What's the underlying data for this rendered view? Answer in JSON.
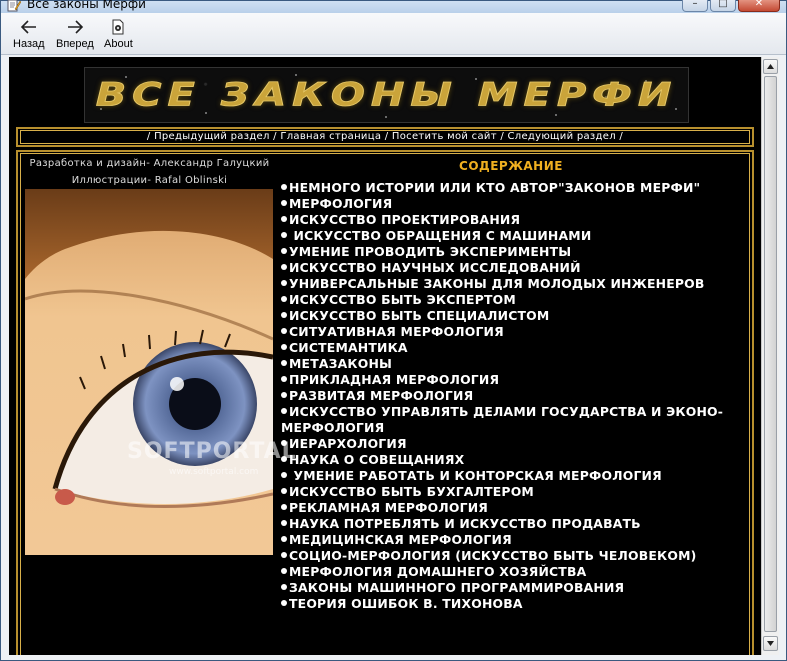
{
  "window": {
    "title": "Все законы Мерфи",
    "controls": {
      "minimize": "–",
      "maximize": "□",
      "close": "✕"
    }
  },
  "toolbar": {
    "back_label": "Назад",
    "forward_label": "Вперед",
    "about_label": "About"
  },
  "banner": {
    "text": "ВСЕ ЗАКОНЫ МЕРФИ"
  },
  "nav": {
    "sep": "/",
    "prev": "Предыдущий раздел",
    "home": "Главная страница",
    "visit": "Посетить мой сайт",
    "next": "Следующий раздел"
  },
  "credits": {
    "design": "Разработка и дизайн- Александр Галуцкий",
    "illustrations": "Иллюстрации- Rafal Oblinski"
  },
  "watermark": {
    "main": "SOFTPORTAL",
    "sub": "www.softportal.com"
  },
  "toc": {
    "title": "СОДЕРЖАНИЕ",
    "items": [
      "НЕМНОГО ИСТОРИИ ИЛИ КТО АВТОР\"ЗАКОНОВ МЕРФИ\"",
      "МЕРФОЛОГИЯ",
      "ИСКУССТВО ПРОЕКТИРОВАНИЯ",
      " ИСКУССТВО ОБРАЩЕНИЯ С МАШИНАМИ",
      "УМЕНИЕ ПРОВОДИТЬ ЭКСПЕРИМЕНТЫ",
      "ИСКУССТВО НАУЧНЫХ ИССЛЕДОВАНИЙ",
      "УНИВЕРСАЛЬНЫЕ ЗАКОНЫ ДЛЯ МОЛОДЫХ ИНЖЕНЕРОВ",
      "ИСКУССТВО БЫТЬ ЭКСПЕРТОМ",
      "ИСКУССТВО БЫТЬ СПЕЦИАЛИСТОМ",
      "СИТУАТИВНАЯ МЕРФОЛОГИЯ",
      "СИСТЕМАНТИКА",
      "МЕТАЗАКОНЫ",
      "ПРИКЛАДНАЯ МЕРФОЛОГИЯ",
      "РАЗВИТАЯ МЕРФОЛОГИЯ",
      "ИСКУССТВО УПРАВЛЯТЬ ДЕЛАМИ ГОСУДАРСТВА И ЭКОНО-МЕРФОЛОГИЯ",
      "ИЕРАРХОЛОГИЯ",
      "НАУКА О СОВЕЩАНИЯХ",
      " УМЕНИЕ РАБОТАТЬ И КОНТОРСКАЯ МЕРФОЛОГИЯ",
      "ИСКУССТВО БЫТЬ БУХГАЛТЕРОМ",
      "РЕКЛАМНАЯ МЕРФОЛОГИЯ",
      "НАУКА ПОТРЕБЛЯТЬ И ИСКУССТВО ПРОДАВАТЬ",
      "МЕДИЦИНСКАЯ МЕРФОЛОГИЯ",
      "СОЦИО-МЕРФОЛОГИЯ (ИСКУССТВО БЫТЬ ЧЕЛОВЕКОМ)",
      "МЕРФОЛОГИЯ ДОМАШНЕГО ХОЗЯЙСТВА",
      "ЗАКОНЫ МАШИННОГО ПРОГРАММИРОВАНИЯ",
      "ТЕОРИЯ ОШИБОК В. ТИХОНОВА"
    ]
  },
  "colors": {
    "accent_gold": "#b8902e",
    "toc_title": "#f0b020",
    "page_bg": "#000000"
  },
  "icons": {
    "app": "notepad-pencil-icon",
    "back": "arrow-left-icon",
    "forward": "arrow-right-icon",
    "about": "document-info-icon"
  }
}
